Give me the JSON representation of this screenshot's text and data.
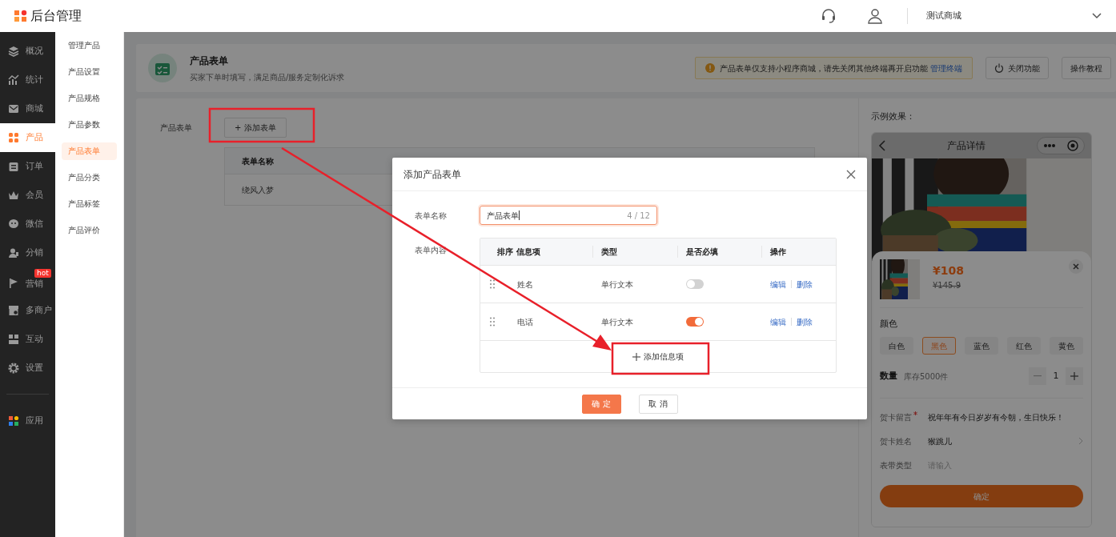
{
  "app": {
    "title": "后台管理"
  },
  "topbar": {
    "store_name": "测试商城"
  },
  "sidebar": {
    "items": [
      {
        "label": "概况",
        "selected": false
      },
      {
        "label": "统计",
        "selected": false
      },
      {
        "label": "商城",
        "selected": false
      },
      {
        "label": "产品",
        "selected": true
      },
      {
        "label": "订单",
        "selected": false
      },
      {
        "label": "会员",
        "selected": false
      },
      {
        "label": "微信",
        "selected": false
      },
      {
        "label": "分销",
        "selected": false
      },
      {
        "label": "营销",
        "selected": false,
        "badge": "hot"
      },
      {
        "label": "多商户",
        "selected": false
      },
      {
        "label": "互动",
        "selected": false
      },
      {
        "label": "设置",
        "selected": false
      },
      {
        "label": "应用",
        "selected": false
      }
    ]
  },
  "submenu": {
    "items": [
      {
        "label": "管理产品",
        "selected": false
      },
      {
        "label": "产品设置",
        "selected": false
      },
      {
        "label": "产品规格",
        "selected": false
      },
      {
        "label": "产品参数",
        "selected": false
      },
      {
        "label": "产品表单",
        "selected": true
      },
      {
        "label": "产品分类",
        "selected": false
      },
      {
        "label": "产品标签",
        "selected": false
      },
      {
        "label": "产品评价",
        "selected": false
      }
    ]
  },
  "page_header": {
    "title": "产品表单",
    "subtitle": "买家下单时填写，满足商品/服务定制化诉求",
    "notice": {
      "text": "产品表单仅支持小程序商城，请先关闭其他终端再开启功能",
      "link": "管理终端"
    },
    "buttons": [
      "关闭功能",
      "操作教程"
    ]
  },
  "forms_section": {
    "label": "产品表单",
    "add_button": "+ 添加表单",
    "table": {
      "columns": [
        "表单名称"
      ],
      "rows": [
        [
          "绕风入梦"
        ]
      ]
    }
  },
  "preview": {
    "label": "示例效果：",
    "title": "产品详情",
    "price": "¥108",
    "original_price": "¥145.9",
    "color_label": "颜色",
    "colors": [
      {
        "label": "白色",
        "selected": false
      },
      {
        "label": "黑色",
        "selected": true
      },
      {
        "label": "蓝色",
        "selected": false
      },
      {
        "label": "红色",
        "selected": false
      },
      {
        "label": "黄色",
        "selected": false
      }
    ],
    "quantity_label": "数量",
    "stock": "库存5000件",
    "quantity": "1",
    "fields": [
      {
        "kind": "text",
        "label": "贺卡留言",
        "required": true,
        "value": "祝年年有今日岁岁有今朝，生日快乐！"
      },
      {
        "kind": "select",
        "label": "贺卡姓名",
        "required": false,
        "value": "猴跳儿"
      },
      {
        "kind": "input",
        "label": "表带类型",
        "required": false,
        "placeholder": "请输入"
      }
    ],
    "confirm": "确定"
  },
  "modal": {
    "title": "添加产品表单",
    "name_label": "表单名称",
    "name_value": "产品表单",
    "name_count": "4 / 12",
    "content_label": "表单内容",
    "columns": [
      "排序",
      "信息项",
      "类型",
      "是否必填",
      "操作"
    ],
    "rows": [
      {
        "name": "姓名",
        "type": "单行文本",
        "required": false,
        "actions": [
          "编辑",
          "删除"
        ]
      },
      {
        "name": "电话",
        "type": "单行文本",
        "required": true,
        "actions": [
          "编辑",
          "删除"
        ]
      }
    ],
    "add_item": "添加信息项",
    "buttons": [
      {
        "label": "确 定",
        "kind": "primary"
      },
      {
        "label": "取 消",
        "kind": "default"
      }
    ]
  }
}
